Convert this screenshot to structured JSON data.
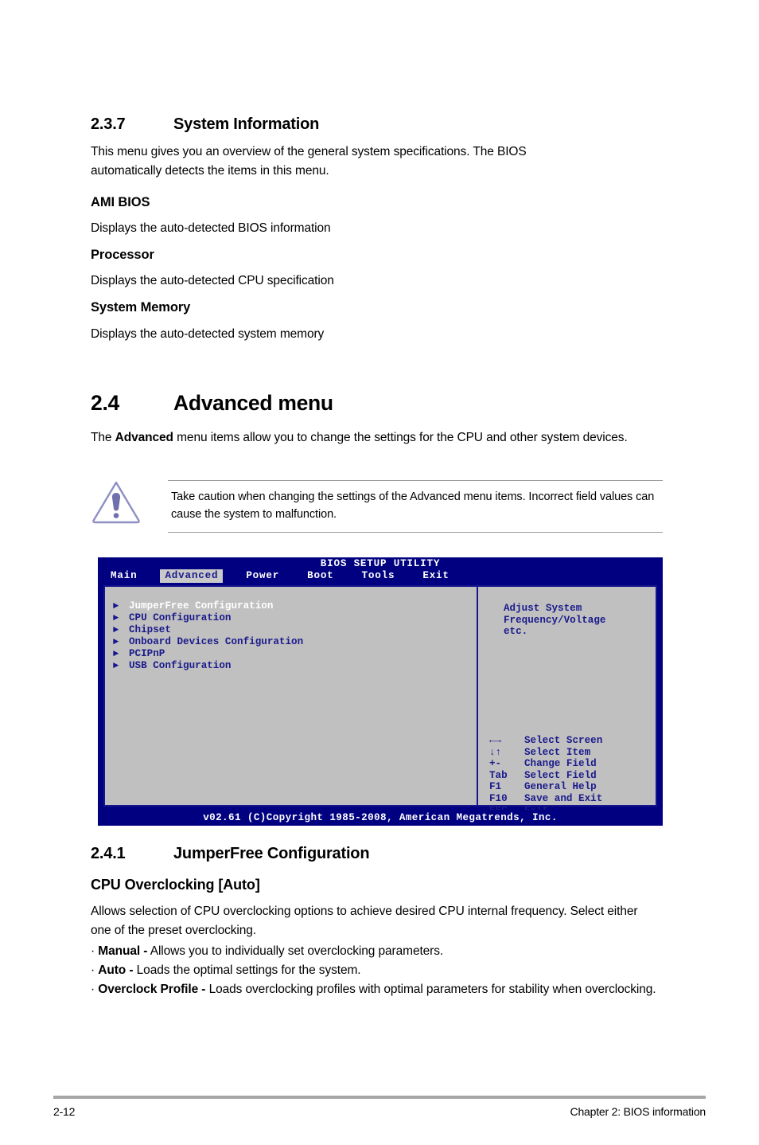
{
  "sections": {
    "s237": {
      "number": "2.3.7",
      "title": "System Information",
      "intro": "This menu gives you an overview of the general system specifications. The BIOS automatically detects the items in this menu.",
      "subsections": [
        {
          "heading": "AMI BIOS",
          "text": "Displays the auto-detected BIOS information"
        },
        {
          "heading": "Processor",
          "text": "Displays the auto-detected CPU specification"
        },
        {
          "heading": "System Memory",
          "text": "Displays the auto-detected system memory"
        }
      ]
    },
    "s24": {
      "number": "2.4",
      "title": "Advanced menu",
      "intro_pre": "The ",
      "intro_bold": "Advanced",
      "intro_post": " menu items allow you to change the settings for the CPU and other system devices."
    },
    "note": {
      "icon": "caution-triangle-icon",
      "text": "Take caution when changing the settings of the Advanced menu items. Incorrect field values can cause the system to malfunction."
    },
    "s241": {
      "number": "2.4.1",
      "title": "JumperFree Configuration",
      "option_heading": "CPU Overclocking [Auto]",
      "description": "Allows selection of CPU overclocking options to achieve desired CPU internal frequency. Select either one of the preset overclocking.",
      "bullets": [
        {
          "marker": "·",
          "term": "Manual -",
          "text": " Allows you to individually set overclocking parameters."
        },
        {
          "marker": "·",
          "term": "Auto -",
          "text": " Loads the optimal settings for the system."
        },
        {
          "marker": "·",
          "term": "Overclock Profile -",
          "text": " Loads overclocking profiles with optimal parameters for stability when overclocking."
        }
      ]
    }
  },
  "bios": {
    "title": "BIOS SETUP UTILITY",
    "tabs": [
      {
        "label": "Main",
        "active": false
      },
      {
        "label": "Advanced",
        "active": true
      },
      {
        "label": "Power",
        "active": false
      },
      {
        "label": "Boot",
        "active": false
      },
      {
        "label": "Tools",
        "active": false
      },
      {
        "label": "Exit",
        "active": false
      }
    ],
    "menu_items": [
      {
        "label": "JumperFree Configuration",
        "selected": true
      },
      {
        "label": "CPU Configuration",
        "selected": false
      },
      {
        "label": "Chipset",
        "selected": false
      },
      {
        "label": "Onboard Devices Configuration",
        "selected": false
      },
      {
        "label": "PCIPnP",
        "selected": false
      },
      {
        "label": "USB Configuration",
        "selected": false
      }
    ],
    "help_text": "Adjust System\nFrequency/Voltage\netc.",
    "keys": [
      {
        "key": "←→",
        "action": "Select Screen"
      },
      {
        "key": "↓↑",
        "action": "Select Item"
      },
      {
        "key": "+-",
        "action": "Change Field"
      },
      {
        "key": "Tab",
        "action": "Select Field"
      },
      {
        "key": "F1",
        "action": "General Help"
      },
      {
        "key": "F10",
        "action": "Save and Exit"
      },
      {
        "key": "ESC",
        "action": "Exit"
      }
    ],
    "footer": "v02.61 (C)Copyright 1985-2008, American Megatrends, Inc.",
    "colors": {
      "chrome": "#000080",
      "panel": "#c0c0c0",
      "text": "#1a1a8c",
      "selected": "#ffffff",
      "tab_active_bg": "#c9c9c9"
    }
  },
  "page_footer": {
    "page_number": "2-12",
    "chapter": "Chapter 2: BIOS information"
  }
}
